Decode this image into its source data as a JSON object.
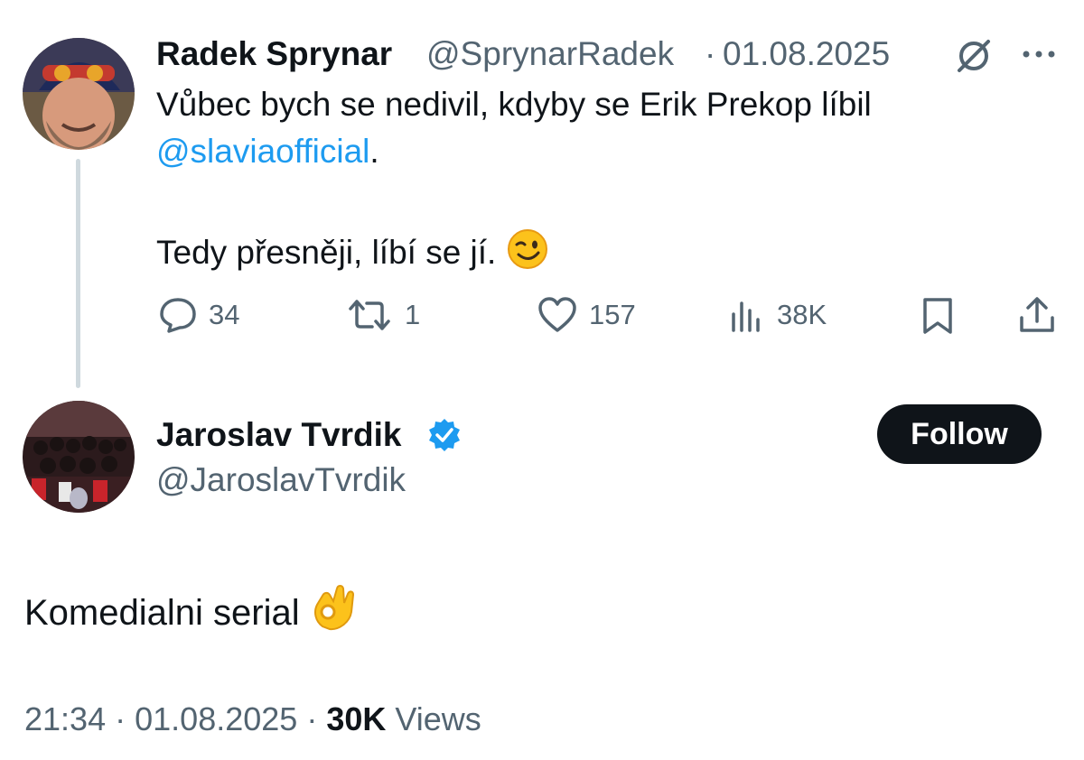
{
  "quoted_tweet": {
    "author_name": "Radek Sprynar",
    "handle": "@SprynarRadek",
    "separator": "·",
    "date": "01.08.2025",
    "text_line1": "Vůbec bych se nedivil, kdyby se Erik Prekop líbil",
    "mention": "@slaviaofficial",
    "mention_suffix": ".",
    "text_line3": "Tedy přesněji, líbí se jí.",
    "replies": "34",
    "reposts": "1",
    "likes": "157",
    "views": "38K",
    "icons": [
      "grok-icon",
      "more-icon",
      "reply-icon",
      "repost-icon",
      "like-icon",
      "views-icon",
      "bookmark-icon",
      "share-icon",
      "winking-face-emoji"
    ]
  },
  "main_tweet": {
    "author_name": "Jaroslav Tvrdik",
    "verified": true,
    "handle": "@JaroslavTvrdik",
    "follow_label": "Follow",
    "text": "Komedialni serial",
    "emoji": "ok-hand-emoji",
    "time": "21:34",
    "separator": "·",
    "date": "01.08.2025",
    "views_count": "30K",
    "views_label": "Views"
  },
  "colors": {
    "text": "#0f1419",
    "muted": "#536471",
    "link": "#1d9bf0",
    "thread_line": "#cfd9de",
    "follow_bg": "#0f1419",
    "verified": "#1d9bf0"
  }
}
